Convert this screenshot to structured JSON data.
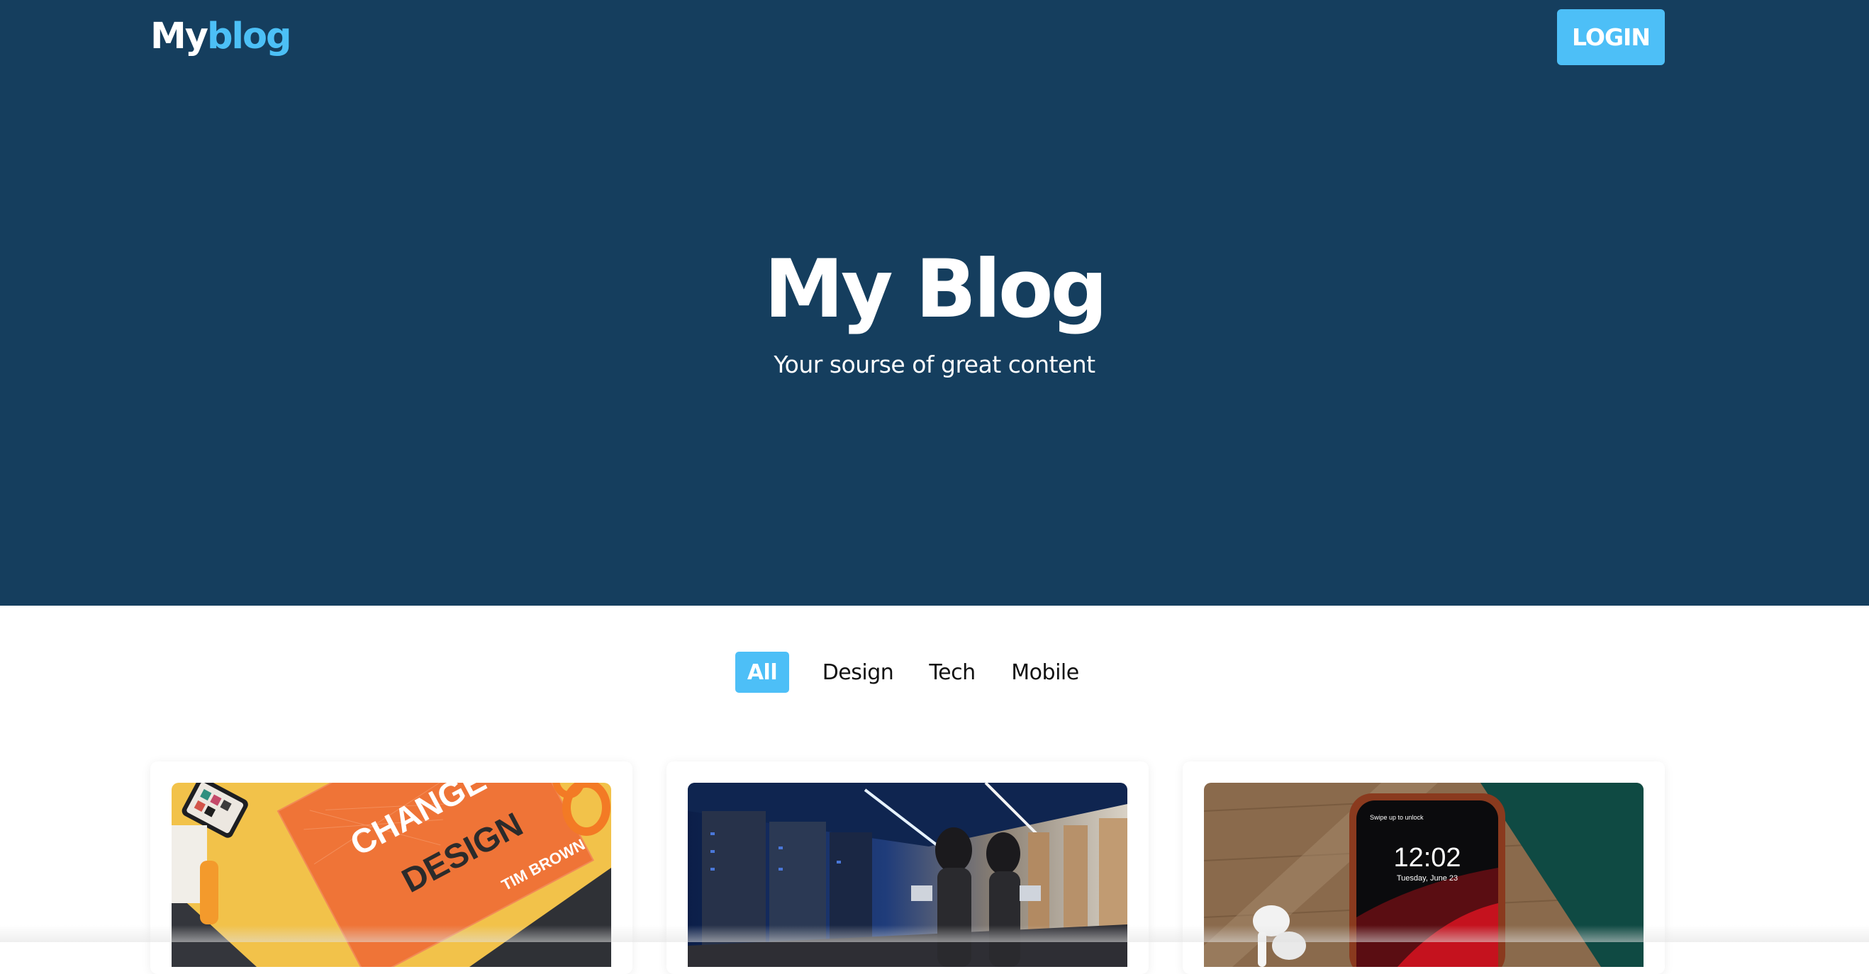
{
  "header": {
    "logo_part1": "My",
    "logo_part2": "blog",
    "login_label": "LOGIN"
  },
  "hero": {
    "title": "My Blog",
    "subtitle": "Your sourse of great content"
  },
  "filters": [
    {
      "label": "All",
      "active": true
    },
    {
      "label": "Design",
      "active": false
    },
    {
      "label": "Tech",
      "active": false
    },
    {
      "label": "Mobile",
      "active": false
    }
  ],
  "cards": [
    {
      "image": "design-book-photo",
      "image_text": {
        "word1": "CHANGE",
        "word2": "DESIGN",
        "author": "TIM BROWN"
      }
    },
    {
      "image": "server-room-photo"
    },
    {
      "image": "smartphone-photo",
      "image_text": {
        "lock_hint": "Swipe up to unlock",
        "time": "12:02",
        "date": "Tuesday, June 23"
      }
    }
  ],
  "colors": {
    "hero_bg": "#153e5e",
    "accent": "#4dbff7",
    "logo_accent": "#4cc0f6",
    "text_dark": "#111111",
    "white": "#ffffff"
  }
}
